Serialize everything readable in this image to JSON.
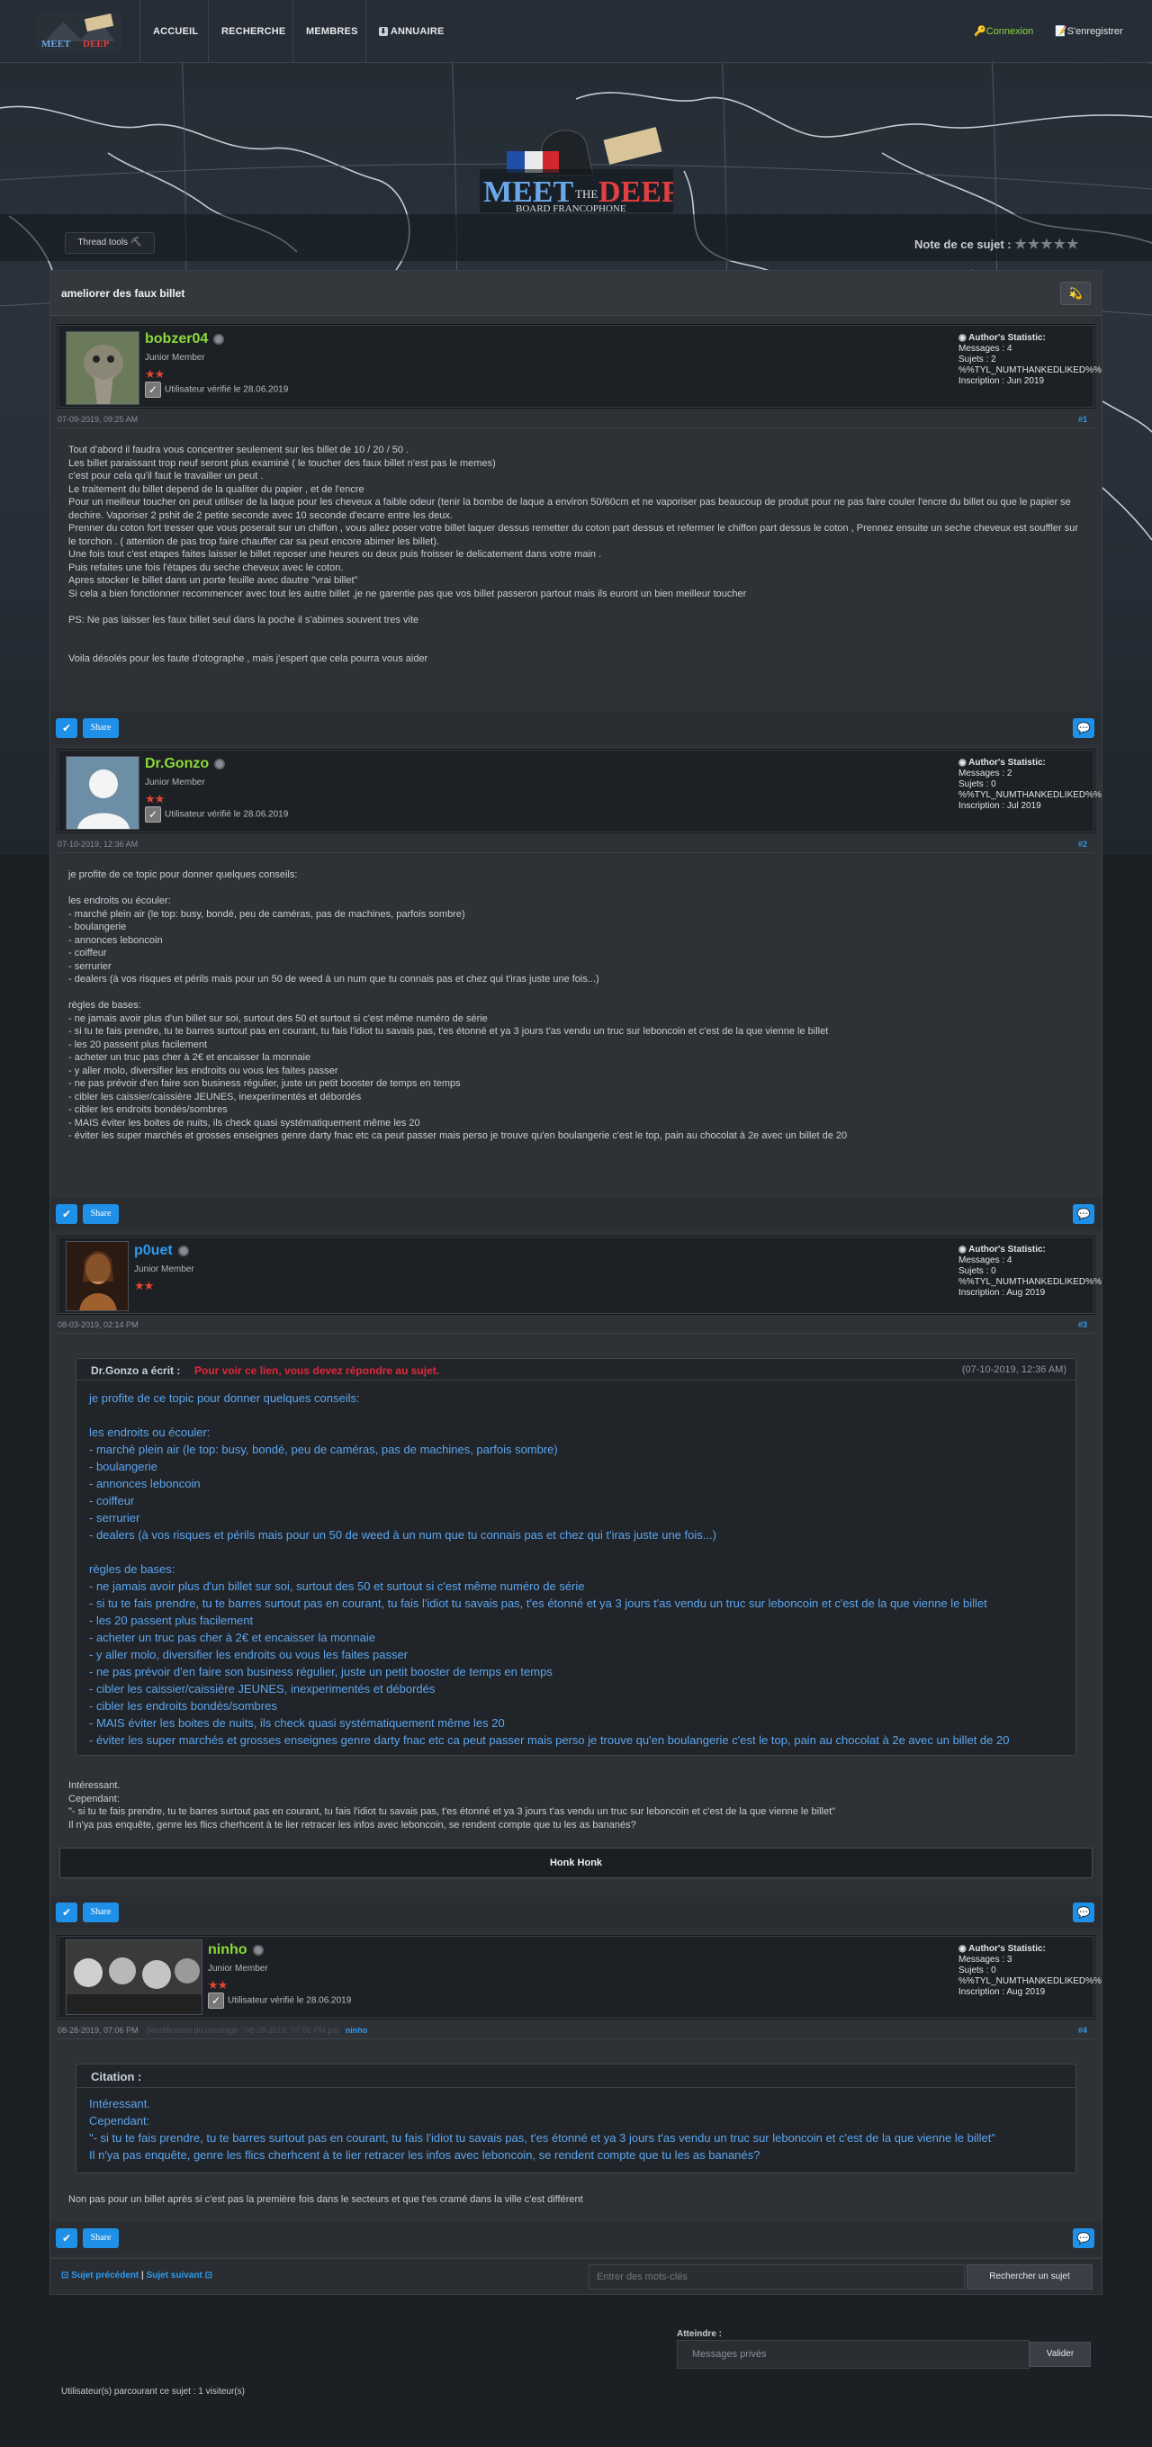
{
  "nav": {
    "items": [
      "ACCUEIL",
      "RECHERCHE",
      "MEMBRES",
      "ANNUAIRE"
    ],
    "login": "Connexion",
    "register": "S'enregistrer"
  },
  "banner": {
    "logo_meet": "MEET",
    "logo_the": "THE",
    "logo_deep": "DEEP",
    "logo_sub": "BOARD FRANCOPHONE",
    "thread_tools": "Thread tools",
    "rating_label": "Note de ce sujet :",
    "rating_stars": "★★★★★"
  },
  "thread": {
    "title": "ameliorer des faux billet"
  },
  "stat_labels": {
    "heading": "Author's Statistic:",
    "messages": "Messages :",
    "sujets": "Sujets :",
    "thanked": "%%TYL_NUMTHANKEDLIKED%%",
    "inscription": "Inscription :"
  },
  "posts": [
    {
      "author": "bobzer04",
      "rank": "Junior Member",
      "stars": "★★",
      "verified": "Utilisateur vérifié le 28.06.2019",
      "stats": {
        "messages": "4",
        "sujets": "2",
        "inscription": "Jun 2019"
      },
      "date": "07-09-2019, 09:25 AM",
      "num": "#1",
      "body": "Tout d'abord il faudra vous concentrer seulement sur les billet de 10 / 20 / 50 .\nLes billet paraissant trop neuf seront plus examiné ( le toucher des faux billet n'est pas le memes)\nc'est pour cela qu'il faut le travailler un peut .\nLe traitement du billet depend de la qualiter du papier , et de l'encre\nPour un meilleur toucher on peut utiliser de la laque pour les cheveux a faible odeur (tenir la bombe de laque a environ 50/60cm et ne vaporiser pas beaucoup de produit pour ne pas faire couler l'encre du billet ou que le papier se dechire. Vaporiser 2 pshit de 2 petite seconde avec 10 seconde d'ecarre entre les deux.\nPrenner du coton fort tresser que vous poserait sur un chiffon , vous allez poser votre billet laquer dessus remetter du coton part dessus et refermer le chiffon part dessus le coton , Prennez ensuite un seche cheveux est souffler sur le torchon . ( attention de pas trop faire chauffer car sa peut encore abimer les billet).\nUne fois tout c'est etapes faites laisser le billet reposer une heures ou deux puis froisser le delicatement dans votre main .\nPuis refaites une fois l'étapes du seche cheveux avec le coton.\nApres stocker le billet dans un porte feuille avec dautre \"vrai billet\"\nSi cela a bien fonctionner recommencer avec tout les autre billet ,je ne garentie pas que vos billet passeron partout mais ils euront un bien meilleur toucher\n\nPS: Ne pas laisser les faux billet seul dans la poche il s'abimes souvent tres vite\n\n\nVoila désolés pour les faute d'otographe , mais j'espert que cela pourra vous aider"
    },
    {
      "author": "Dr.Gonzo",
      "rank": "Junior Member",
      "stars": "★★",
      "verified": "Utilisateur vérifié le 28.06.2019",
      "stats": {
        "messages": "2",
        "sujets": "0",
        "inscription": "Jul 2019"
      },
      "date": "07-10-2019, 12:36 AM",
      "num": "#2",
      "body": "je profite de ce topic pour donner quelques conseils:\n\nles endroits ou écouler:\n- marché plein air (le top: busy, bondé, peu de caméras, pas de machines, parfois sombre)\n- boulangerie\n- annonces leboncoin\n- coiffeur\n- serrurier\n- dealers (à vos risques et périls mais pour un 50 de weed à un num que tu connais pas et chez qui t'iras juste une fois...)\n\nrègles de bases:\n- ne jamais avoir plus d'un billet sur soi, surtout des 50 et surtout si c'est même numéro de série\n- si tu te fais prendre, tu te barres surtout pas en courant, tu fais l'idiot tu savais pas, t'es étonné et ya 3 jours t'as vendu un truc sur leboncoin et c'est de la que vienne le billet\n- les 20 passent plus facilement\n- acheter un truc pas cher à 2€ et encaisser la monnaie\n- y aller molo, diversifier les endroits ou vous les faites passer\n- ne pas prévoir d'en faire son business régulier, juste un petit booster de temps en temps\n- cibler les caissier/caissière JEUNES, inexperimentés et débordés\n- cibler les endroits bondés/sombres\n- MAIS éviter les boites de nuits, ils check quasi systématiquement même les 20\n- éviter les super marchés et grosses enseignes genre darty fnac etc ca peut passer mais perso je trouve qu'en boulangerie c'est le top, pain au chocolat à 2e avec un billet de 20"
    },
    {
      "author": "p0uet",
      "rank": "Junior Member",
      "stars": "★★",
      "stats": {
        "messages": "4",
        "sujets": "0",
        "inscription": "Aug 2019"
      },
      "date": "08-03-2019, 02:14 PM",
      "num": "#3",
      "quote_author": "Dr.Gonzo a écrit :",
      "quote_link": "Pour voir ce lien, vous devez répondre au sujet.",
      "quote_date": "(07-10-2019, 12:36 AM)",
      "quote_body": "je profite de ce topic pour donner quelques conseils:\n\nles endroits ou écouler:\n- marché plein air (le top: busy, bondé, peu de caméras, pas de machines, parfois sombre)\n- boulangerie\n- annonces leboncoin\n- coiffeur\n- serrurier\n- dealers (à vos risques et périls mais pour un 50 de weed à un num que tu connais pas et chez qui t'iras juste une fois...)\n\nrègles de bases:\n- ne jamais avoir plus d'un billet sur soi, surtout des 50 et surtout si c'est même numéro de série\n- si tu te fais prendre, tu te barres surtout pas en courant, tu fais l'idiot tu savais pas, t'es étonné et ya 3 jours t'as vendu un truc sur leboncoin et c'est de la que vienne le billet\n- les 20 passent plus facilement\n- acheter un truc pas cher à 2€ et encaisser la monnaie\n- y aller molo, diversifier les endroits ou vous les faites passer\n- ne pas prévoir d'en faire son business régulier, juste un petit booster de temps en temps\n- cibler les caissier/caissière JEUNES, inexperimentés et débordés\n- cibler les endroits bondés/sombres\n- MAIS éviter les boites de nuits, ils check quasi systématiquement même les 20\n- éviter les super marchés et grosses enseignes genre darty fnac etc ca peut passer mais perso je trouve qu'en boulangerie c'est le top, pain au chocolat à 2e avec un billet de 20",
      "body": "Intéressant.\nCependant:\n\"- si tu te fais prendre, tu te barres surtout pas en courant, tu fais l'idiot tu savais pas, t'es étonné et ya 3 jours t'as vendu un truc sur leboncoin et c'est de la que vienne le billet\"\nIl n'ya pas enquête, genre les flics cherhcent à te lier retracer les infos avec leboncoin, se rendent compte que tu les as bananés?",
      "signature": "Honk Honk"
    },
    {
      "author": "ninho",
      "rank": "Junior Member",
      "stars": "★★",
      "verified": "Utilisateur vérifié le 28.06.2019",
      "stats": {
        "messages": "3",
        "sujets": "0",
        "inscription": "Aug 2019"
      },
      "date": "08-28-2019, 07:06 PM",
      "edited": "(Modification du message : 08-28-2019, 07:06 PM par",
      "edited_by": "ninho",
      "num": "#4",
      "quote_author": "Citation :",
      "quote_body": "Intéressant.\nCependant:\n\"- si tu te fais prendre, tu te barres surtout pas en courant, tu fais l'idiot tu savais pas, t'es étonné et ya 3 jours t'as vendu un truc sur leboncoin et c'est de la que vienne le billet\"\nIl n'ya pas enquête, genre les flics cherhcent à te lier retracer les infos avec leboncoin, se rendent compte que tu les as bananés?",
      "body": "Non pas pour un billet après si c'est pas la première fois dans le secteurs et que t'es cramé dans la ville c'est différent"
    }
  ],
  "actions": {
    "share": "Share"
  },
  "footer": {
    "prev": "Sujet précédent",
    "sep": "|",
    "next": "Sujet suivant",
    "search_placeholder": "Entrer des mots-clés",
    "search_button": "Rechercher un sujet",
    "jump_label": "Atteindre :",
    "jump_value": "Messages privés",
    "jump_button": "Valider",
    "viewers": "Utilisateur(s) parcourant ce sujet : 1 visiteur(s)"
  },
  "colors": {
    "accent": "#1e90e8",
    "username_green": "#8bd93a",
    "username_blue": "#2e9bf0",
    "link_red": "#e0283a"
  }
}
